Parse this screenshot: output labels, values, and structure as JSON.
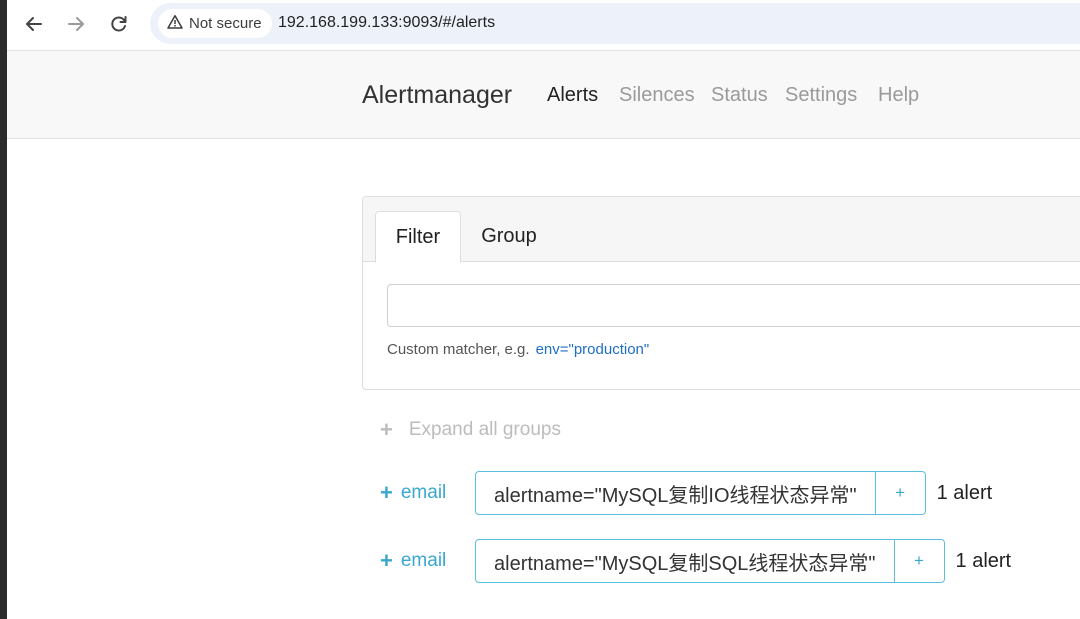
{
  "browser": {
    "security_label": "Not secure",
    "url": "192.168.199.133:9093/#/alerts"
  },
  "navbar": {
    "brand": "Alertmanager",
    "links": [
      "Alerts",
      "Silences",
      "Status",
      "Settings",
      "Help"
    ],
    "active": "Alerts"
  },
  "filter_card": {
    "tabs": [
      "Filter",
      "Group"
    ],
    "active_tab": "Filter",
    "input_value": "",
    "hint_label": "Custom matcher, e.g.",
    "hint_example": "env=\"production\""
  },
  "expand_all_label": "Expand all groups",
  "groups": [
    {
      "receiver": "email",
      "label": "alertname=\"MySQL复制IO线程状态异常\"",
      "add_label": "+",
      "count": "1 alert"
    },
    {
      "receiver": "email",
      "label": "alertname=\"MySQL复制SQL线程状态异常\"",
      "add_label": "+",
      "count": "1 alert"
    }
  ],
  "colors": {
    "accent": "#5bc0de",
    "link_blue": "#1f6fc5",
    "navbar_bg": "#f8f8f8"
  }
}
